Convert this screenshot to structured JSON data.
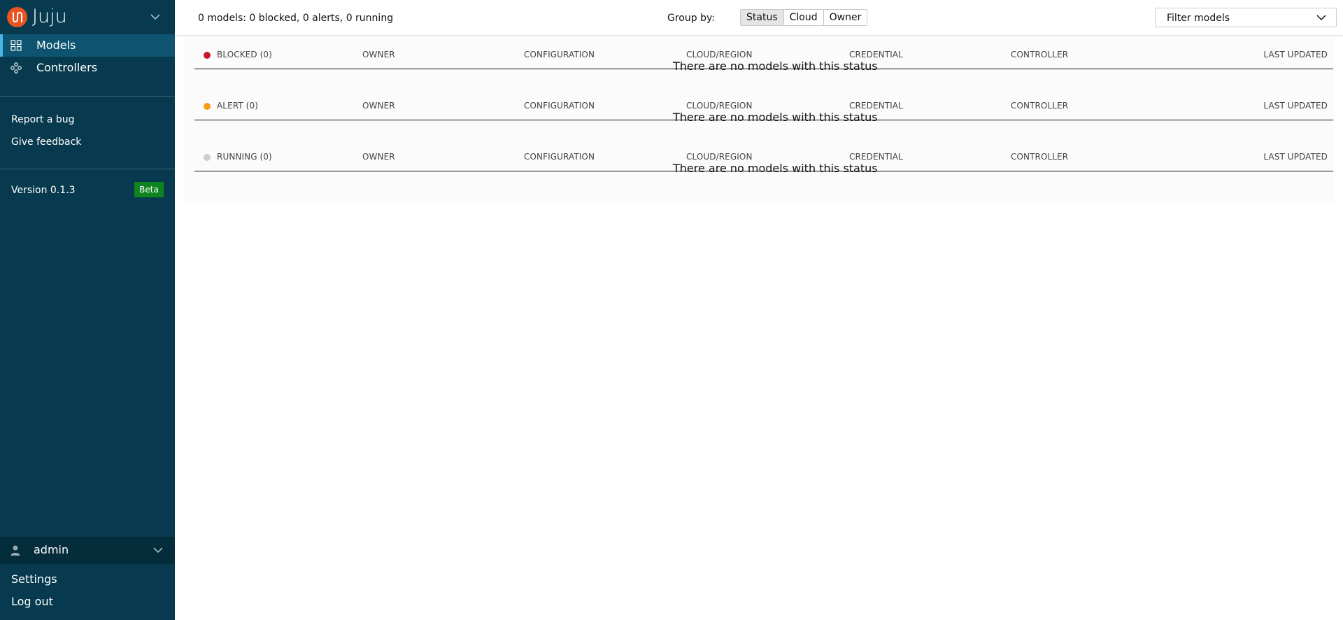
{
  "sidebar": {
    "brand": "Juju",
    "nav": [
      {
        "label": "Models",
        "icon": "models-icon",
        "active": true
      },
      {
        "label": "Controllers",
        "icon": "controllers-icon",
        "active": false
      }
    ],
    "links": {
      "report_bug": "Report a bug",
      "feedback": "Give feedback"
    },
    "version": "Version 0.1.3",
    "beta": "Beta",
    "user": {
      "name": "admin",
      "settings": "Settings",
      "logout": "Log out"
    }
  },
  "header": {
    "summary": "0 models: 0 blocked, 0 alerts, 0 running",
    "group_by_label": "Group by:",
    "group_by_options": [
      "Status",
      "Cloud",
      "Owner"
    ],
    "group_by_selected": "Status",
    "filter_placeholder": "Filter models"
  },
  "columns": {
    "owner": "OWNER",
    "configuration": "CONFIGURATION",
    "cloud_region": "CLOUD/REGION",
    "credential": "CREDENTIAL",
    "controller": "CONTROLLER",
    "last_updated": "LAST UPDATED"
  },
  "groups": [
    {
      "label": "BLOCKED (0)",
      "color": "#c7162b",
      "empty": "There are no models with this status"
    },
    {
      "label": "ALERT (0)",
      "color": "#f99b11",
      "empty": "There are no models with this status"
    },
    {
      "label": "RUNNING (0)",
      "color": "#cdcdcd",
      "empty": "There are no models with this status"
    }
  ],
  "colors": {
    "sidebar_bg": "#073a4e",
    "active_nav": "#0e5470",
    "brand_accent": "#e95420",
    "beta_badge": "#0e8420"
  }
}
